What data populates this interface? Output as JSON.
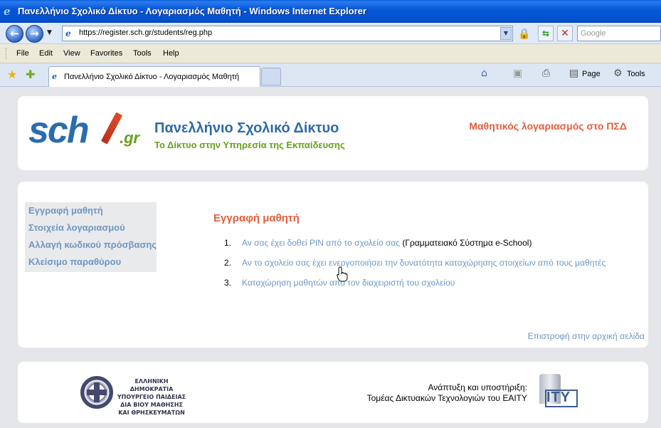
{
  "window": {
    "title": "Πανελλήνιο Σχολικό Δίκτυο - Λογαριασμός Μαθητή - Windows Internet Explorer"
  },
  "address": {
    "url": "https://register.sch.gr/students/reg.php",
    "search_placeholder": "Google"
  },
  "menu": [
    "File",
    "Edit",
    "View",
    "Favorites",
    "Tools",
    "Help"
  ],
  "tab": {
    "label": "Πανελλήνιο Σχολικό Δίκτυο - Λογαριασμός Μαθητή"
  },
  "commands": {
    "page": "Page",
    "tools": "Tools"
  },
  "header": {
    "logo_text": "sch",
    "logo_suffix": ".gr",
    "title": "Πανελλήνιο Σχολικό Δίκτυο",
    "subtitle": "Το Δίκτυο στην Υπηρεσία της Εκπαίδευσης",
    "account": "Μαθητικός λογαριασμός στο ΠΣΔ"
  },
  "sidebar": {
    "items": [
      {
        "label": "Εγγραφή μαθητή"
      },
      {
        "label": "Στοιχεία λογαριασμού"
      },
      {
        "label": "Αλλαγή κωδικού πρόσβασης"
      },
      {
        "label": "Κλείσιμο παραθύρου"
      }
    ]
  },
  "main": {
    "title": "Εγγραφή μαθητή",
    "options": [
      {
        "num": "1.",
        "link": "Αν σας έχει δοθεί PIN από το σχολείο σας",
        "note": " (Γραμματειακό Σύστημα e-School)"
      },
      {
        "num": "2.",
        "link": "Αν το σχολείο σας έχει ενεργοποιήσει την δυνατότητα καταχώρησης στοιχείων από τους μαθητές",
        "note": ""
      },
      {
        "num": "3.",
        "link": "Καταχώρηση μαθητών από τον διαχειριστή του σχολείου",
        "note": ""
      }
    ],
    "back_link": "Επιστροφή στην αρχική σελίδα"
  },
  "footer": {
    "ministry_lines": [
      "ΕΛΛΗΝΙΚΗ ΔΗΜΟΚΡΑΤΙΑ",
      "ΥΠΟΥΡΓΕΙΟ ΠΑΙΔΕΙΑΣ",
      "ΔΙΑ ΒΙΟΥ ΜΑΘΗΣΗΣ",
      "ΚΑΙ ΘΡΗΣΚΕΥΜΑΤΩΝ"
    ],
    "dev_line1": "Ανάπτυξη και υποστήριξη:",
    "dev_line2": "Τομέας Δικτυακών Τεχνολογιών του ΕΑΙΤΥ",
    "eaity_text": "ITY"
  }
}
